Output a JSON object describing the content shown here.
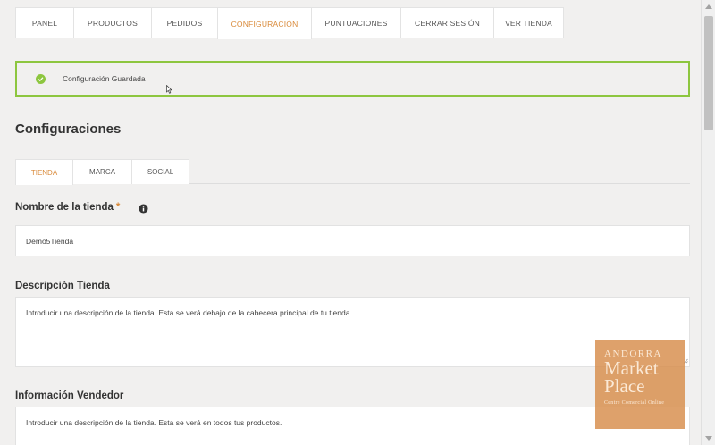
{
  "nav": {
    "tabs": [
      {
        "label": "PANEL"
      },
      {
        "label": "PRODUCTOS"
      },
      {
        "label": "PEDIDOS"
      },
      {
        "label": "CONFIGURACIÓN"
      },
      {
        "label": "PUNTUACIONES"
      },
      {
        "label": "CERRAR SESIÓN"
      },
      {
        "label": "VER TIENDA"
      }
    ],
    "active": "CONFIGURACIÓN"
  },
  "alert": {
    "message": "Configuración Guardada",
    "icon": "check-circle-icon",
    "color": "#8dc63f"
  },
  "page_title": "Configuraciones",
  "subtabs": {
    "tabs": [
      {
        "label": "TIENDA"
      },
      {
        "label": "MARCA"
      },
      {
        "label": "SOCIAL"
      }
    ],
    "active": "TIENDA"
  },
  "form": {
    "store_name": {
      "label": "Nombre de la tienda",
      "required_mark": "*",
      "value": "Demo5Tienda"
    },
    "store_description": {
      "label": "Descripción Tienda",
      "value": "Introducir una descripción de la tienda. Esta se verá debajo de la cabecera principal de tu tienda."
    },
    "vendor_info": {
      "label": "Información Vendedor",
      "value": "Introducir una descripción de la tienda. Esta se verá en todos tus productos."
    }
  },
  "watermark": {
    "line1": "ANDORRA",
    "line2": "Market",
    "line3": "Place",
    "line4": "Centre Comercial Online"
  },
  "colors": {
    "accent": "#d98a3a",
    "success": "#8dc63f",
    "background": "#f1f0ef"
  }
}
